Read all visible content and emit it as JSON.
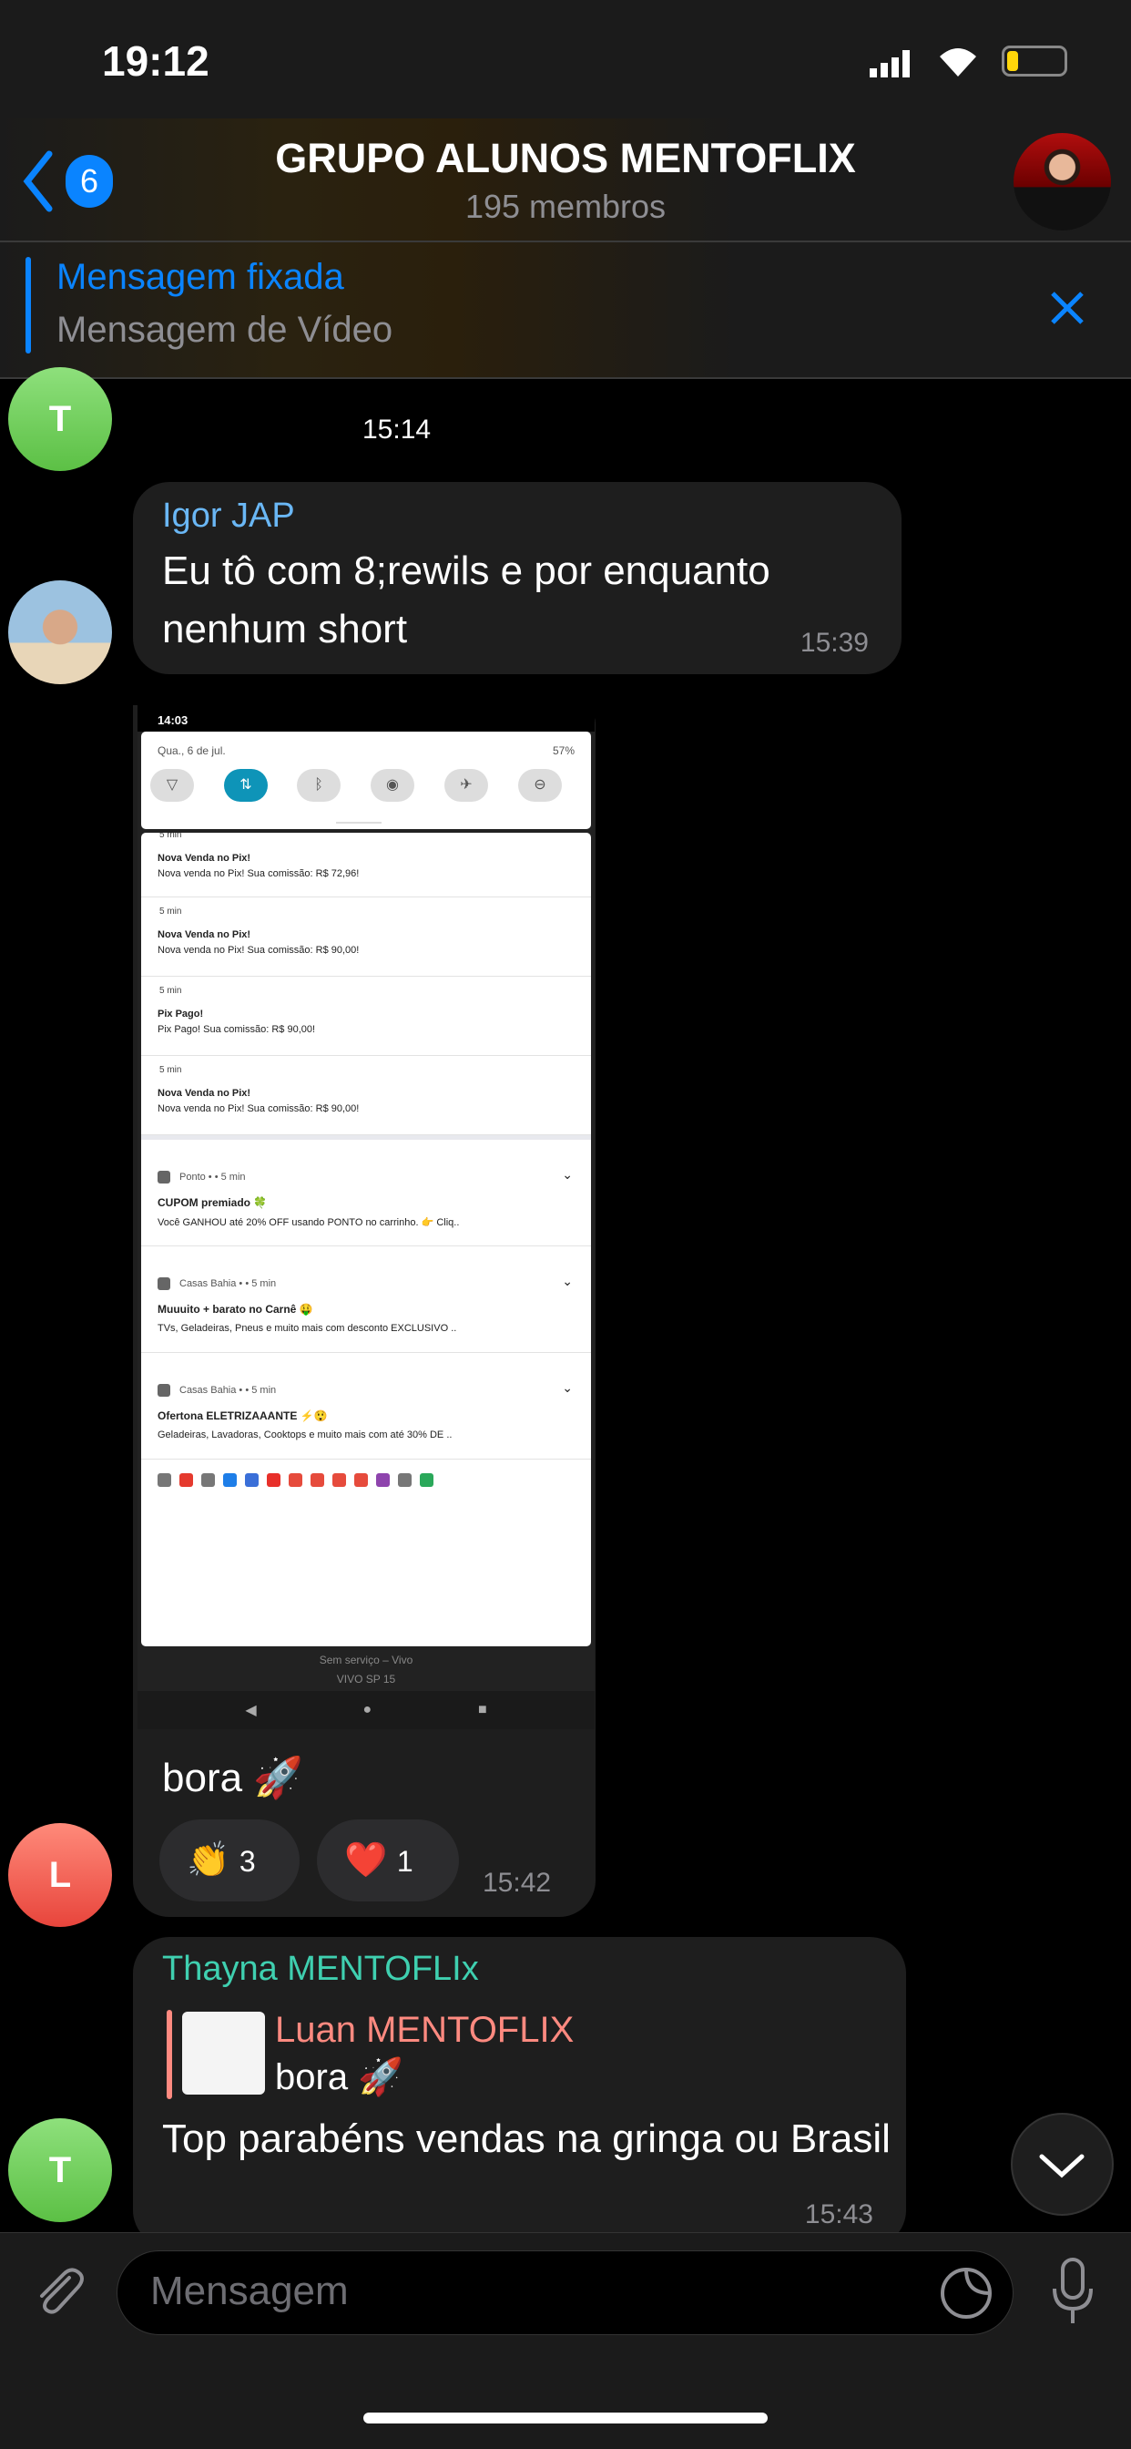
{
  "status_bar": {
    "time": "19:12",
    "battery_level": 0.2,
    "battery_color": "#ffd60a"
  },
  "header": {
    "back_badge": "6",
    "title": "GRUPO ALUNOS MENTOFLIX",
    "subtitle": "195 membros",
    "accent": "#0a84ff"
  },
  "pinned": {
    "label": "Mensagem fixada",
    "text": "Mensagem de Vídeo"
  },
  "messages": [
    {
      "avatar": "T",
      "time": "15:14"
    },
    {
      "sender": "Igor JAP",
      "sender_color": "#6ab7f5",
      "text": "Eu tô com 8;rewils e por enquanto nenhum short",
      "time": "15:39"
    },
    {
      "avatar": "L",
      "caption": "bora 🚀",
      "time": "15:42",
      "reactions": [
        {
          "emoji": "👏",
          "count": "3"
        },
        {
          "emoji": "❤️",
          "count": "1"
        }
      ]
    },
    {
      "avatar": "T",
      "sender": "Thayna MENTOFLIx",
      "sender_color": "#3fd0b0",
      "reply": {
        "sender": "Luan MENTOFLIX",
        "sender_color": "#ff8a80",
        "text": "bora 🚀"
      },
      "text": "Top parabéns vendas na gringa ou Brasil",
      "time": "15:43"
    }
  ],
  "screenshot": {
    "time": "14:03",
    "date": "Qua., 6 de jul.",
    "status": "57%",
    "quick_settings": [
      "wifi-icon",
      "data-icon",
      "bluetooth-icon",
      "hotspot-icon",
      "airplane-icon",
      "dnd-icon"
    ],
    "active_tile_color": "#0e94b8",
    "notifications": [
      {
        "meta": "5 min",
        "title": "Nova Venda no Pix!",
        "body": "Nova venda no Pix! Sua comissão: R$ 72,96!"
      },
      {
        "meta": "5 min",
        "title": "Nova Venda no Pix!",
        "body": "Nova venda no Pix! Sua comissão: R$ 90,00!"
      },
      {
        "meta": "5 min",
        "title": "Pix Pago!",
        "body": "Pix Pago! Sua comissão: R$ 90,00!"
      },
      {
        "meta": "5 min",
        "title": "Nova Venda no Pix!",
        "body": "Nova venda no Pix! Sua comissão: R$ 90,00!"
      }
    ],
    "app_notifications": [
      {
        "app": "Ponto •  • 5 min",
        "title": "CUPOM premiado 🍀",
        "body": "Você GANHOU até 20% OFF usando PONTO no carrinho. 👉 Cliq.."
      },
      {
        "app": "Casas Bahia •  • 5 min",
        "title": "Muuuito + barato no Carnê 🤑",
        "body": "TVs, Geladeiras, Pneus e muito mais com desconto EXCLUSIVO .."
      },
      {
        "app": "Casas Bahia •  • 5 min",
        "title": "Ofertona ELETRIZAAANTE ⚡😲",
        "body": "Geladeiras, Lavadoras, Cooktops e muito mais com até 30% DE .."
      }
    ],
    "tray_colors": [
      "#777",
      "#e53a2e",
      "#777",
      "#1e7ee8",
      "#3a6fd8",
      "#e8302a",
      "#e64b3c",
      "#e64b3c",
      "#e64b3c",
      "#e64b3c",
      "#8e44ad",
      "#777",
      "#2aa85a"
    ],
    "carrier_line1": "Sem serviço – Vivo",
    "carrier_line2": "VIVO SP 15"
  },
  "composer": {
    "placeholder": "Mensagem"
  }
}
